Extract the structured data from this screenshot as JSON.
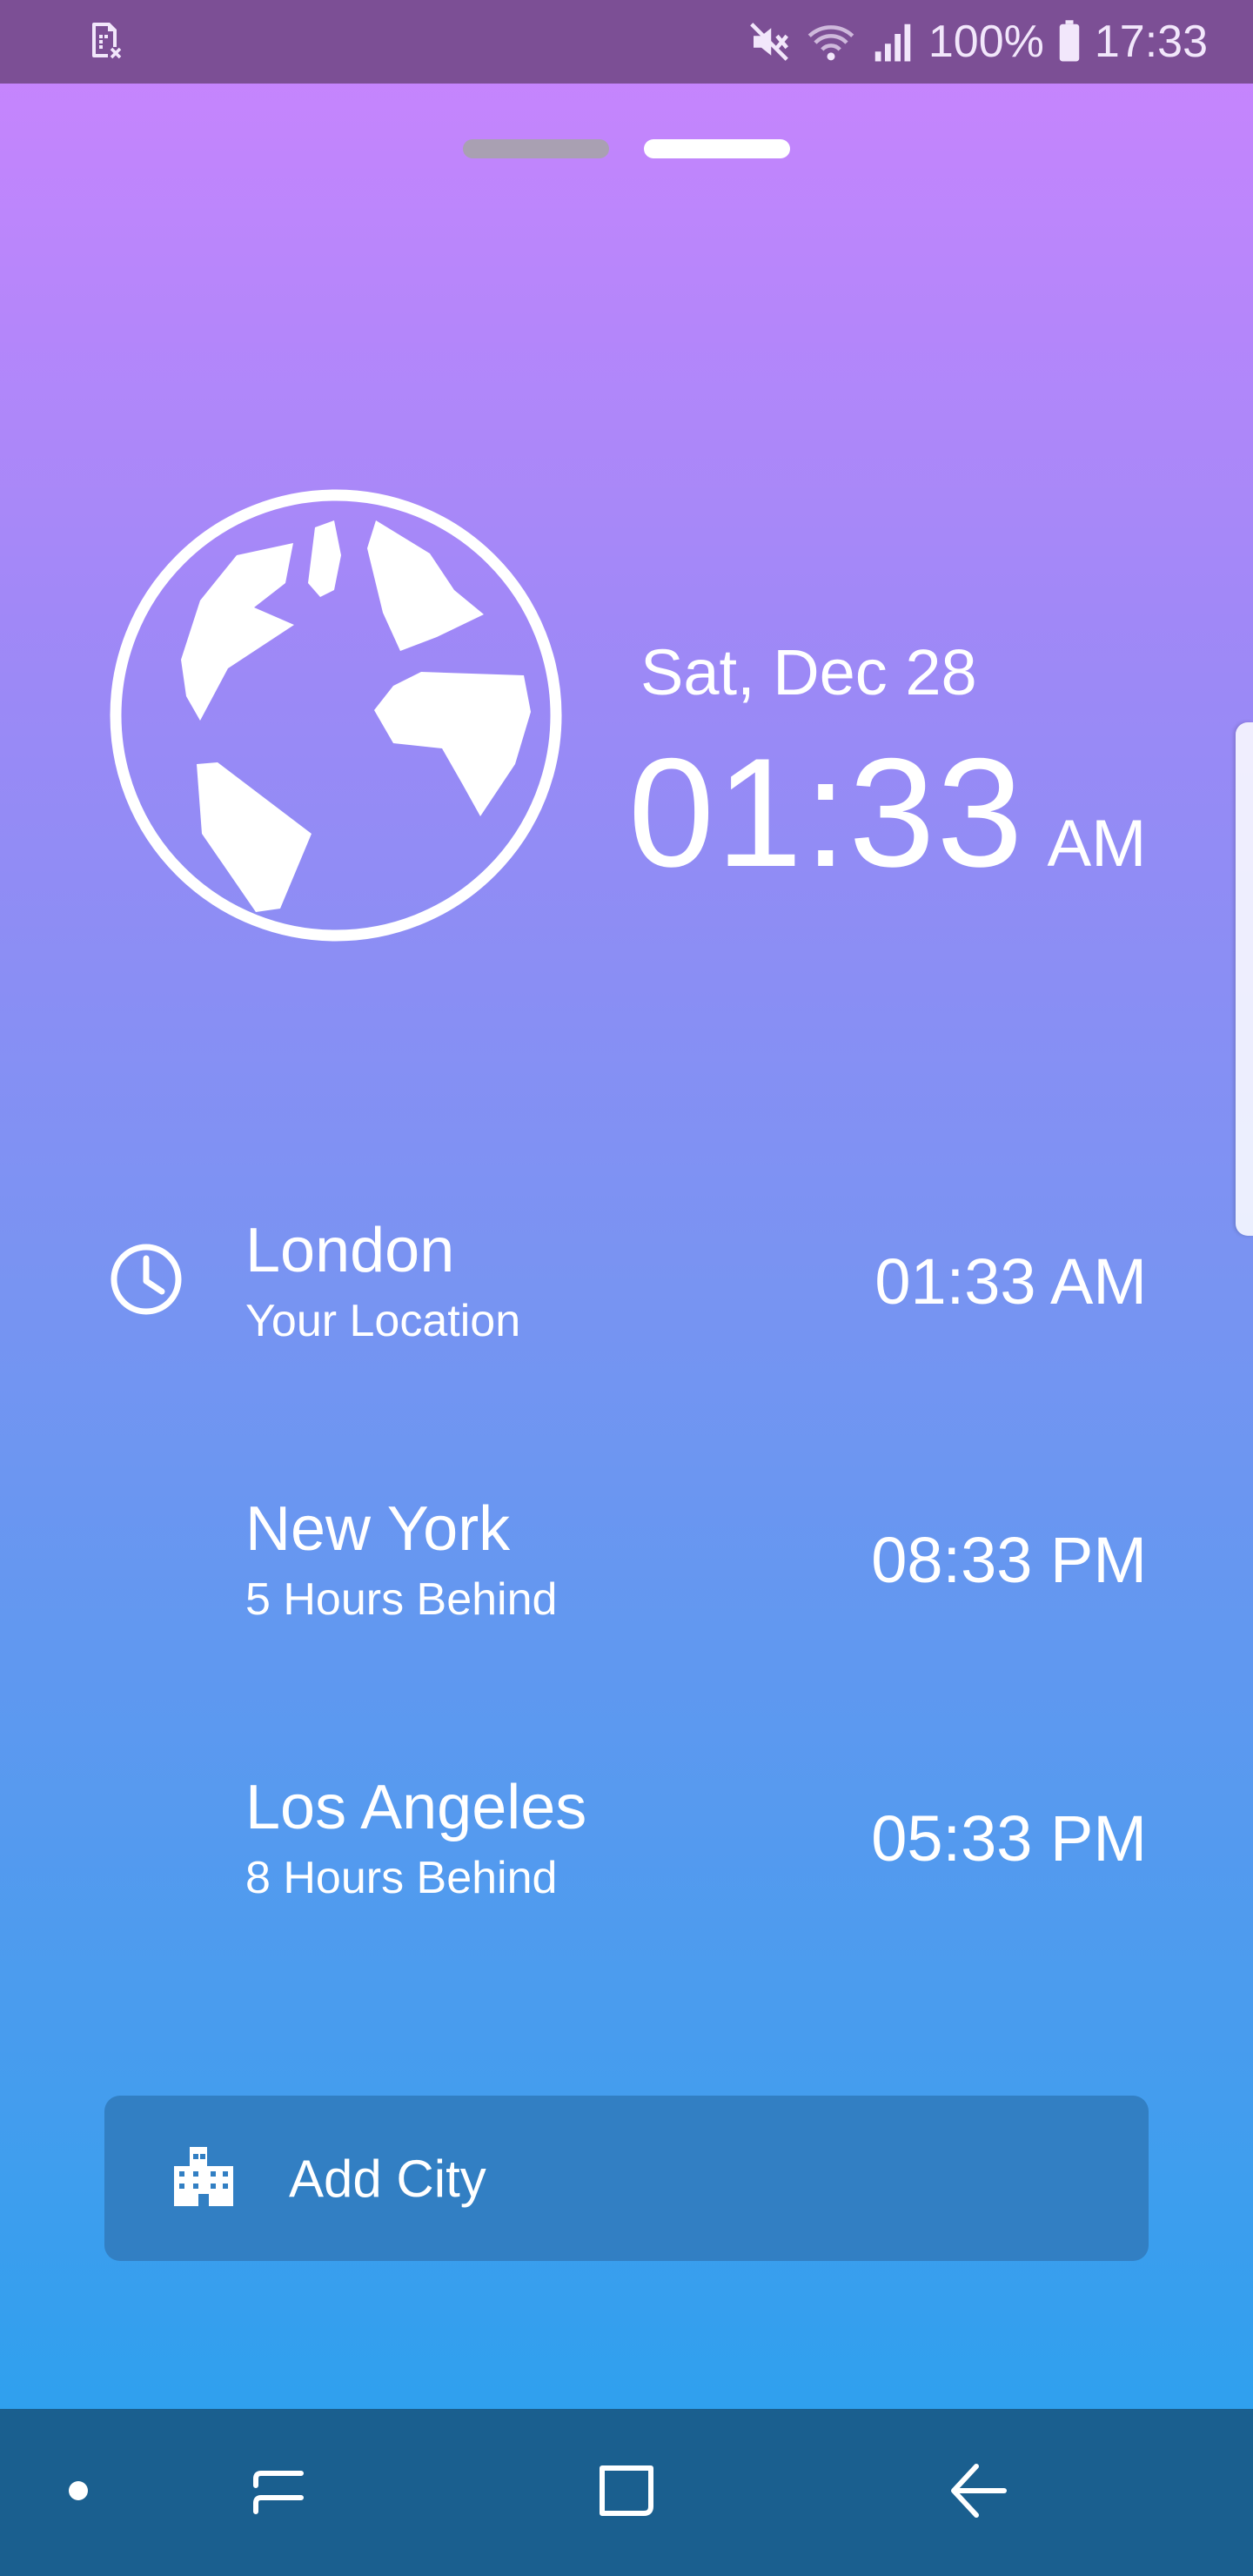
{
  "status_bar": {
    "battery": "100%",
    "clock": "17:33",
    "icons": [
      "sim-card-error-icon",
      "mute-icon",
      "wifi-icon",
      "signal-icon",
      "battery-icon"
    ]
  },
  "pager": {
    "pages": 2,
    "active_page": 2
  },
  "hero": {
    "date": "Sat, Dec 28",
    "time": "01:33",
    "ampm": "AM",
    "icon": "globe-icon"
  },
  "cities": [
    {
      "name": "London",
      "subtitle": "Your Location",
      "time": "01:33 AM",
      "icon": "clock-icon"
    },
    {
      "name": "New York",
      "subtitle": "5 Hours Behind",
      "time": "08:33 PM"
    },
    {
      "name": "Los Angeles",
      "subtitle": "8 Hours Behind",
      "time": "05:33 PM"
    }
  ],
  "add_city": {
    "label": "Add City",
    "icon": "building-icon"
  },
  "nav_bar": {
    "items": [
      "dot-icon",
      "recent-apps-icon",
      "home-icon",
      "back-icon"
    ]
  },
  "colors": {
    "gradient_top": "#cb84fe",
    "gradient_bottom": "#2fa0ee",
    "status_bar": "#7c4f95",
    "add_city_bg": "#327fc3",
    "nav_bar": "#1a5f8f"
  }
}
